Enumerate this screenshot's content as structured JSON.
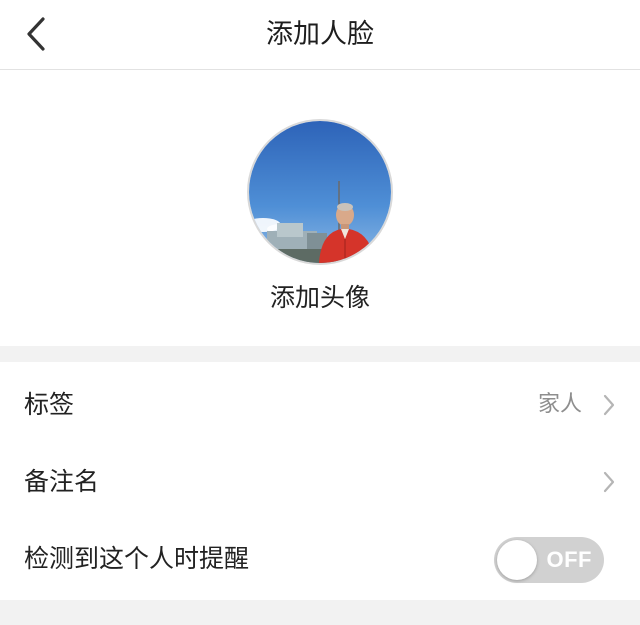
{
  "nav": {
    "title": "添加人脸",
    "back_icon": "chevron-left-icon"
  },
  "avatar": {
    "label": "添加头像",
    "photo_description": "person in red jacket under blue sky"
  },
  "settings": {
    "tag": {
      "label": "标签",
      "value": "家人"
    },
    "remark": {
      "label": "备注名",
      "value": ""
    },
    "alert": {
      "label": "检测到这个人时提醒",
      "toggle_text": "OFF",
      "enabled": false
    }
  },
  "colors": {
    "toggle_off": "#d1d1d1",
    "page_bg": "#f2f2f2",
    "secondary_text": "#8e8e8e"
  }
}
